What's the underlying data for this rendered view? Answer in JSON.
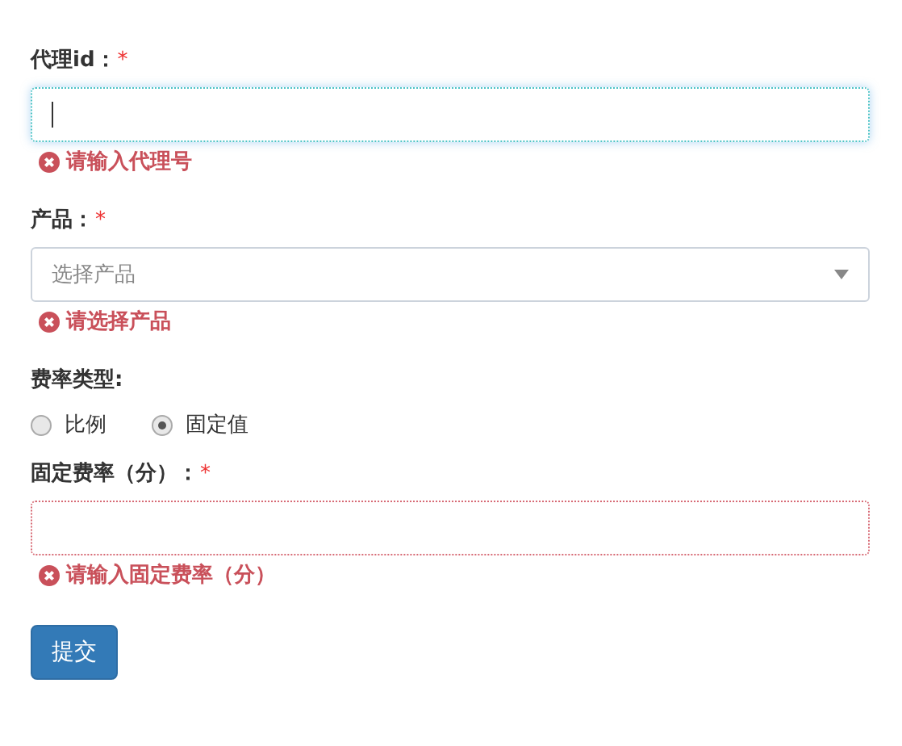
{
  "fields": [
    {
      "kind": "text",
      "label": "代理id：",
      "required_mark": "*",
      "focused": true,
      "error": "请输入代理号"
    },
    {
      "kind": "select",
      "label": "产品：",
      "required_mark": "*",
      "placeholder": "选择产品",
      "error": "请选择产品"
    },
    {
      "kind": "radio",
      "label": "费率类型:",
      "options": [
        {
          "label": "比例",
          "selected": false
        },
        {
          "label": "固定值",
          "selected": true
        }
      ]
    },
    {
      "kind": "text",
      "label": "固定费率（分）：",
      "required_mark": "*",
      "invalid": true,
      "error": "请输入固定费率（分）"
    }
  ],
  "submit": "提交"
}
